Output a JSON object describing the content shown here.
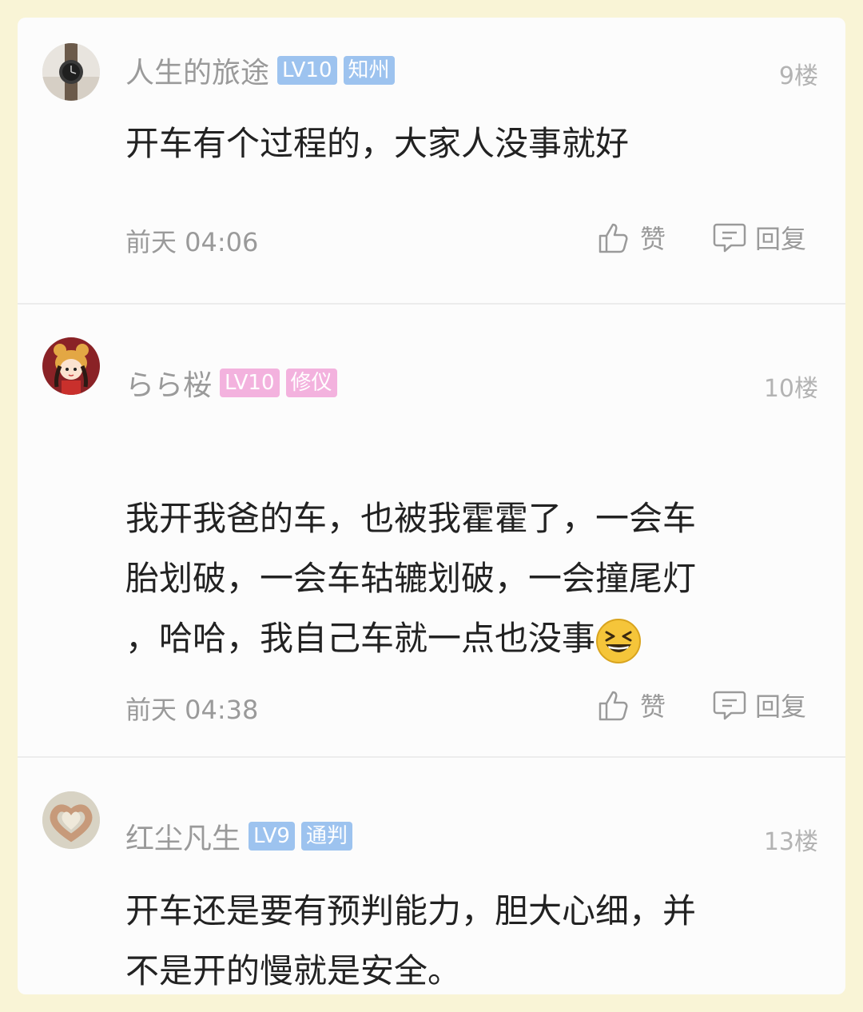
{
  "comments": [
    {
      "username": "人生的旅途",
      "level": "LV10",
      "level_color": "#9dc3ef",
      "tag": "知州",
      "tag_color": "#9dc3ef",
      "floor": "9楼",
      "text": "开车有个过程的，大家人没事就好",
      "time": "前天 04:06",
      "like_label": "赞",
      "reply_label": "回复",
      "avatar_icon": "wristwatch-avatar"
    },
    {
      "username": "らら桜",
      "level": "LV10",
      "level_color": "#f3b2de",
      "tag": "修仪",
      "tag_color": "#f3b2de",
      "floor": "10楼",
      "text": "我开我爸的车，也被我霍霍了，一会车\n胎划破，一会车轱辘划破，一会撞尾灯\n，哈哈，我自己车就一点也没事",
      "emoji": "laughing-emoji",
      "time": "前天 04:38",
      "like_label": "赞",
      "reply_label": "回复",
      "avatar_icon": "cartoon-girl-avatar"
    },
    {
      "username": "红尘凡生",
      "level": "LV9",
      "level_color": "#9dc3ef",
      "tag": "通判",
      "tag_color": "#9dc3ef",
      "floor": "13楼",
      "text": "开车还是要有预判能力，胆大心细，并\n不是开的慢就是安全。",
      "avatar_icon": "heart-hands-avatar"
    }
  ]
}
